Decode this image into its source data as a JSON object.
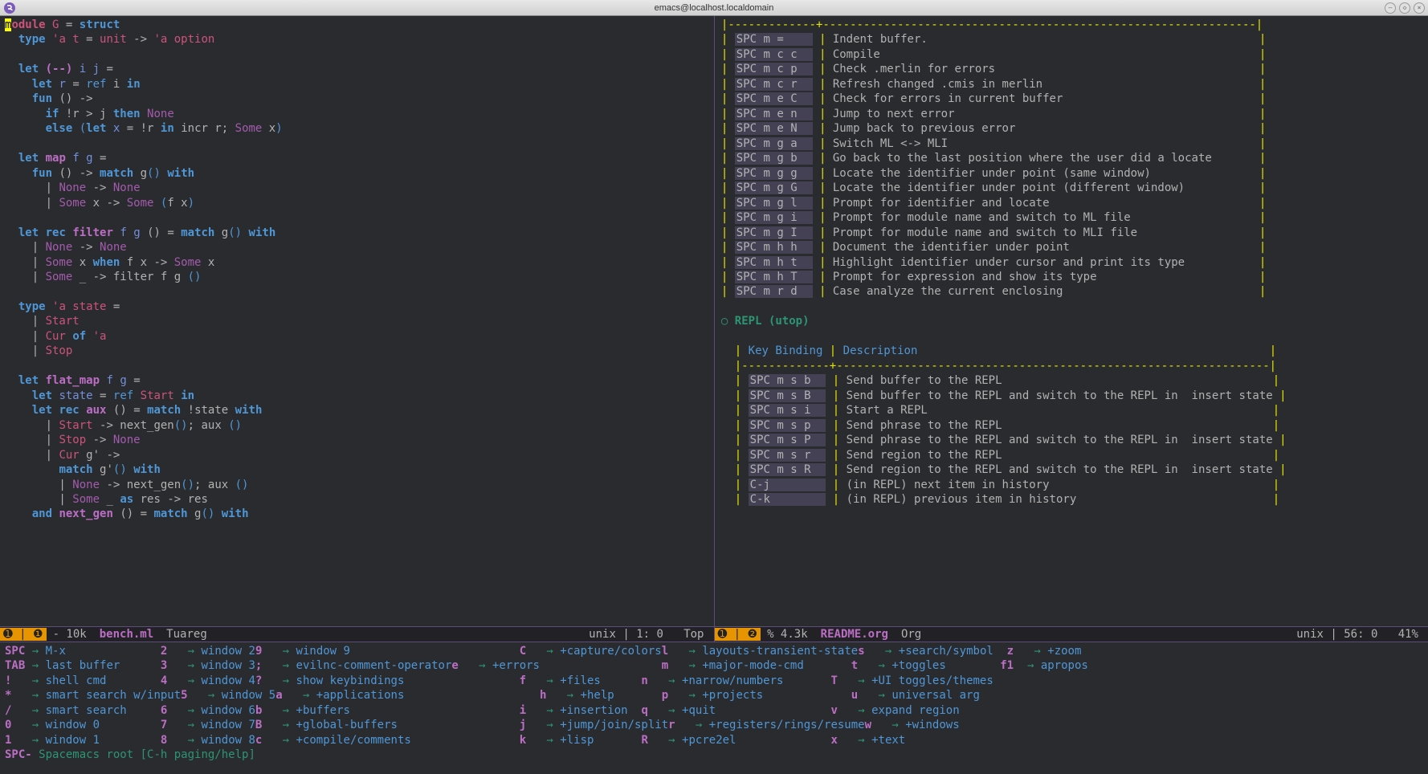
{
  "titlebar": {
    "title": "emacs@localhost.localdomain"
  },
  "code_lines": [
    [
      [
        "hl-first",
        "m"
      ],
      [
        "hl-module",
        "odule"
      ],
      [
        "op",
        " "
      ],
      [
        "ty",
        "G"
      ],
      [
        "op",
        " = "
      ],
      [
        "kw",
        "struct"
      ]
    ],
    [
      [
        "op",
        "  "
      ],
      [
        "kw",
        "type"
      ],
      [
        "op",
        " "
      ],
      [
        "ty",
        "'a t"
      ],
      [
        "op",
        " = "
      ],
      [
        "ty",
        "unit"
      ],
      [
        "op",
        " -> "
      ],
      [
        "ty",
        "'a option"
      ]
    ],
    [
      [
        "op",
        ""
      ]
    ],
    [
      [
        "op",
        "  "
      ],
      [
        "kw",
        "let"
      ],
      [
        "op",
        " "
      ],
      [
        "fn",
        "(--)"
      ],
      [
        "op",
        " "
      ],
      [
        "var",
        "i j"
      ],
      [
        "op",
        " ="
      ]
    ],
    [
      [
        "op",
        "    "
      ],
      [
        "kw",
        "let"
      ],
      [
        "op",
        " "
      ],
      [
        "var",
        "r"
      ],
      [
        "op",
        " = "
      ],
      [
        "kw2",
        "ref"
      ],
      [
        "op",
        " i "
      ],
      [
        "kw",
        "in"
      ]
    ],
    [
      [
        "op",
        "    "
      ],
      [
        "kw",
        "fun"
      ],
      [
        "op",
        " () ->"
      ]
    ],
    [
      [
        "op",
        "      "
      ],
      [
        "kw",
        "if"
      ],
      [
        "op",
        " !r > j "
      ],
      [
        "kw",
        "then"
      ],
      [
        "op",
        " "
      ],
      [
        "none",
        "None"
      ]
    ],
    [
      [
        "op",
        "      "
      ],
      [
        "kw",
        "else"
      ],
      [
        "op",
        " "
      ],
      [
        "paren1",
        "("
      ],
      [
        "kw",
        "let"
      ],
      [
        "op",
        " "
      ],
      [
        "var",
        "x"
      ],
      [
        "op",
        " = !r "
      ],
      [
        "kw",
        "in"
      ],
      [
        "op",
        " incr r; "
      ],
      [
        "none",
        "Some"
      ],
      [
        "op",
        " x"
      ],
      [
        "paren1",
        ")"
      ]
    ],
    [
      [
        "op",
        ""
      ]
    ],
    [
      [
        "op",
        "  "
      ],
      [
        "kw",
        "let"
      ],
      [
        "op",
        " "
      ],
      [
        "fn",
        "map"
      ],
      [
        "op",
        " "
      ],
      [
        "var",
        "f g"
      ],
      [
        "op",
        " ="
      ]
    ],
    [
      [
        "op",
        "    "
      ],
      [
        "kw",
        "fun"
      ],
      [
        "op",
        " () -> "
      ],
      [
        "kw",
        "match"
      ],
      [
        "op",
        " g"
      ],
      [
        "paren1",
        "()"
      ],
      [
        "op",
        " "
      ],
      [
        "kw",
        "with"
      ]
    ],
    [
      [
        "op",
        "      | "
      ],
      [
        "none",
        "None"
      ],
      [
        "op",
        " -> "
      ],
      [
        "none",
        "None"
      ]
    ],
    [
      [
        "op",
        "      | "
      ],
      [
        "none",
        "Some"
      ],
      [
        "op",
        " x -> "
      ],
      [
        "none",
        "Some"
      ],
      [
        "op",
        " "
      ],
      [
        "paren1",
        "("
      ],
      [
        "op",
        "f x"
      ],
      [
        "paren1",
        ")"
      ]
    ],
    [
      [
        "op",
        ""
      ]
    ],
    [
      [
        "op",
        "  "
      ],
      [
        "kw",
        "let"
      ],
      [
        "op",
        " "
      ],
      [
        "kw",
        "rec"
      ],
      [
        "op",
        " "
      ],
      [
        "fn",
        "filter"
      ],
      [
        "op",
        " "
      ],
      [
        "var",
        "f g"
      ],
      [
        "op",
        " () = "
      ],
      [
        "kw",
        "match"
      ],
      [
        "op",
        " g"
      ],
      [
        "paren1",
        "()"
      ],
      [
        "op",
        " "
      ],
      [
        "kw",
        "with"
      ]
    ],
    [
      [
        "op",
        "    | "
      ],
      [
        "none",
        "None"
      ],
      [
        "op",
        " -> "
      ],
      [
        "none",
        "None"
      ]
    ],
    [
      [
        "op",
        "    | "
      ],
      [
        "none",
        "Some"
      ],
      [
        "op",
        " x "
      ],
      [
        "kw",
        "when"
      ],
      [
        "op",
        " f x -> "
      ],
      [
        "none",
        "Some"
      ],
      [
        "op",
        " x"
      ]
    ],
    [
      [
        "op",
        "    | "
      ],
      [
        "none",
        "Some"
      ],
      [
        "op",
        " _ -> filter f g "
      ],
      [
        "paren1",
        "()"
      ]
    ],
    [
      [
        "op",
        ""
      ]
    ],
    [
      [
        "op",
        "  "
      ],
      [
        "kw",
        "type"
      ],
      [
        "op",
        " "
      ],
      [
        "ty",
        "'a state"
      ],
      [
        "op",
        " ="
      ]
    ],
    [
      [
        "op",
        "    | "
      ],
      [
        "ty",
        "Start"
      ]
    ],
    [
      [
        "op",
        "    | "
      ],
      [
        "ty",
        "Cur"
      ],
      [
        "op",
        " "
      ],
      [
        "kw",
        "of"
      ],
      [
        "op",
        " "
      ],
      [
        "ty",
        "'a"
      ]
    ],
    [
      [
        "op",
        "    | "
      ],
      [
        "ty",
        "Stop"
      ]
    ],
    [
      [
        "op",
        ""
      ]
    ],
    [
      [
        "op",
        "  "
      ],
      [
        "kw",
        "let"
      ],
      [
        "op",
        " "
      ],
      [
        "fn",
        "flat_map"
      ],
      [
        "op",
        " "
      ],
      [
        "var",
        "f g"
      ],
      [
        "op",
        " ="
      ]
    ],
    [
      [
        "op",
        "    "
      ],
      [
        "kw",
        "let"
      ],
      [
        "op",
        " "
      ],
      [
        "var",
        "state"
      ],
      [
        "op",
        " = "
      ],
      [
        "kw2",
        "ref"
      ],
      [
        "op",
        " "
      ],
      [
        "ty",
        "Start"
      ],
      [
        "op",
        " "
      ],
      [
        "kw",
        "in"
      ]
    ],
    [
      [
        "op",
        "    "
      ],
      [
        "kw",
        "let"
      ],
      [
        "op",
        " "
      ],
      [
        "kw",
        "rec"
      ],
      [
        "op",
        " "
      ],
      [
        "fn",
        "aux"
      ],
      [
        "op",
        " () = "
      ],
      [
        "kw",
        "match"
      ],
      [
        "op",
        " !state "
      ],
      [
        "kw",
        "with"
      ]
    ],
    [
      [
        "op",
        "      | "
      ],
      [
        "ty",
        "Start"
      ],
      [
        "op",
        " -> next_gen"
      ],
      [
        "paren1",
        "()"
      ],
      [
        "op",
        "; aux "
      ],
      [
        "paren1",
        "()"
      ]
    ],
    [
      [
        "op",
        "      | "
      ],
      [
        "ty",
        "Stop"
      ],
      [
        "op",
        " -> "
      ],
      [
        "none",
        "None"
      ]
    ],
    [
      [
        "op",
        "      | "
      ],
      [
        "ty",
        "Cur"
      ],
      [
        "op",
        " g' ->"
      ]
    ],
    [
      [
        "op",
        "        "
      ],
      [
        "kw",
        "match"
      ],
      [
        "op",
        " g'"
      ],
      [
        "paren1",
        "()"
      ],
      [
        "op",
        " "
      ],
      [
        "kw",
        "with"
      ]
    ],
    [
      [
        "op",
        "        | "
      ],
      [
        "none",
        "None"
      ],
      [
        "op",
        " -> next_gen"
      ],
      [
        "paren1",
        "()"
      ],
      [
        "op",
        "; aux "
      ],
      [
        "paren1",
        "()"
      ]
    ],
    [
      [
        "op",
        "        | "
      ],
      [
        "none",
        "Some"
      ],
      [
        "op",
        " _ "
      ],
      [
        "kw",
        "as"
      ],
      [
        "op",
        " res -> res"
      ]
    ],
    [
      [
        "op",
        "    "
      ],
      [
        "kw",
        "and"
      ],
      [
        "op",
        " "
      ],
      [
        "fn",
        "next_gen"
      ],
      [
        "op",
        " () = "
      ],
      [
        "kw",
        "match"
      ],
      [
        "op",
        " g"
      ],
      [
        "paren1",
        "()"
      ],
      [
        "op",
        " "
      ],
      [
        "kw",
        "with"
      ]
    ]
  ],
  "readme_table1": [
    [
      "SPC m =",
      "Indent buffer."
    ],
    [
      "SPC m c c",
      "Compile"
    ],
    [
      "SPC m c p",
      "Check .merlin for errors"
    ],
    [
      "SPC m c r",
      "Refresh changed .cmis in merlin"
    ],
    [
      "SPC m e C",
      "Check for errors in current buffer"
    ],
    [
      "SPC m e n",
      "Jump to next error"
    ],
    [
      "SPC m e N",
      "Jump back to previous error"
    ],
    [
      "SPC m g a",
      "Switch ML <-> MLI"
    ],
    [
      "SPC m g b",
      "Go back to the last position where the user did a locate"
    ],
    [
      "SPC m g g",
      "Locate the identifier under point (same window)"
    ],
    [
      "SPC m g G",
      "Locate the identifier under point (different window)"
    ],
    [
      "SPC m g l",
      "Prompt for identifier and locate"
    ],
    [
      "SPC m g i",
      "Prompt for module name and switch to ML file"
    ],
    [
      "SPC m g I",
      "Prompt for module name and switch to MLI file"
    ],
    [
      "SPC m h h",
      "Document the identifier under point"
    ],
    [
      "SPC m h t",
      "Highlight identifier under cursor and print its type"
    ],
    [
      "SPC m h T",
      "Prompt for expression and show its type"
    ],
    [
      "SPC m r d",
      "Case analyze the current enclosing"
    ]
  ],
  "readme_heading": "REPL (utop)",
  "readme_table2_header": [
    "Key Binding",
    "Description"
  ],
  "readme_table2": [
    [
      "SPC m s b",
      "Send buffer to the REPL"
    ],
    [
      "SPC m s B",
      "Send buffer to the REPL and switch to the REPL in  insert state"
    ],
    [
      "SPC m s i",
      "Start a REPL"
    ],
    [
      "SPC m s p",
      "Send phrase to the REPL"
    ],
    [
      "SPC m s P",
      "Send phrase to the REPL and switch to the REPL in  insert state"
    ],
    [
      "SPC m s r",
      "Send region to the REPL"
    ],
    [
      "SPC m s R",
      "Send region to the REPL and switch to the REPL in  insert state"
    ],
    [
      "C-j",
      "(in REPL) next item in history"
    ],
    [
      "C-k",
      "(in REPL) previous item in history"
    ]
  ],
  "modeline_left": {
    "icons": "➊ | ❶",
    "size": "- 10k",
    "file": "bench.ml",
    "mode": "Tuareg",
    "encoding": "unix",
    "pos": "1: 0",
    "scroll": "Top"
  },
  "modeline_right": {
    "icons": "➊ | ❷",
    "size": "% 4.3k",
    "file": "README.org",
    "mode": "Org",
    "encoding": "unix",
    "pos": "56: 0",
    "scroll": "41%"
  },
  "which_key": {
    "rows": [
      [
        [
          "SPC",
          "M-x"
        ],
        [
          "2",
          "window 2"
        ],
        [
          "9",
          "window 9"
        ],
        [
          "",
          ""
        ],
        [
          "C",
          "+capture/colors"
        ],
        [
          "l",
          "layouts-transient-state"
        ],
        [
          "s",
          "+search/symbol"
        ],
        [
          "z",
          "+zoom"
        ]
      ],
      [
        [
          "TAB",
          "last buffer"
        ],
        [
          "3",
          "window 3"
        ],
        [
          ";",
          "evilnc-comment-operator"
        ],
        [
          "e",
          "+errors"
        ],
        [
          "",
          ""
        ],
        [
          "m",
          "+major-mode-cmd"
        ],
        [
          "t",
          "+toggles"
        ],
        [
          "f1",
          "apropos"
        ]
      ],
      [
        [
          "!",
          "shell cmd"
        ],
        [
          "4",
          "window 4"
        ],
        [
          "?",
          "show keybindings"
        ],
        [
          "",
          ""
        ],
        [
          "f",
          "+files"
        ],
        [
          "n",
          "+narrow/numbers"
        ],
        [
          "T",
          "+UI toggles/themes"
        ],
        [
          "",
          ""
        ]
      ],
      [
        [
          "*",
          "smart search w/input"
        ],
        [
          "5",
          "window 5"
        ],
        [
          "a",
          "+applications"
        ],
        [
          "",
          ""
        ],
        [
          "h",
          "+help"
        ],
        [
          "p",
          "+projects"
        ],
        [
          "u",
          "universal arg"
        ],
        [
          "",
          ""
        ]
      ],
      [
        [
          "/",
          "smart search"
        ],
        [
          "6",
          "window 6"
        ],
        [
          "b",
          "+buffers"
        ],
        [
          "",
          ""
        ],
        [
          "i",
          "+insertion"
        ],
        [
          "q",
          "+quit"
        ],
        [
          "v",
          "expand region"
        ],
        [
          "",
          ""
        ]
      ],
      [
        [
          "0",
          "window 0"
        ],
        [
          "7",
          "window 7"
        ],
        [
          "B",
          "+global-buffers"
        ],
        [
          "",
          ""
        ],
        [
          "j",
          "+jump/join/split"
        ],
        [
          "r",
          "+registers/rings/resume"
        ],
        [
          "w",
          "+windows"
        ],
        [
          "",
          ""
        ]
      ],
      [
        [
          "1",
          "window 1"
        ],
        [
          "8",
          "window 8"
        ],
        [
          "c",
          "+compile/comments"
        ],
        [
          "",
          ""
        ],
        [
          "k",
          "+lisp"
        ],
        [
          "R",
          "+pcre2el"
        ],
        [
          "x",
          "+text"
        ],
        [
          "",
          ""
        ]
      ]
    ],
    "footer_prefix": "SPC-",
    "footer_text": "Spacemacs root [C-h paging/help]"
  }
}
